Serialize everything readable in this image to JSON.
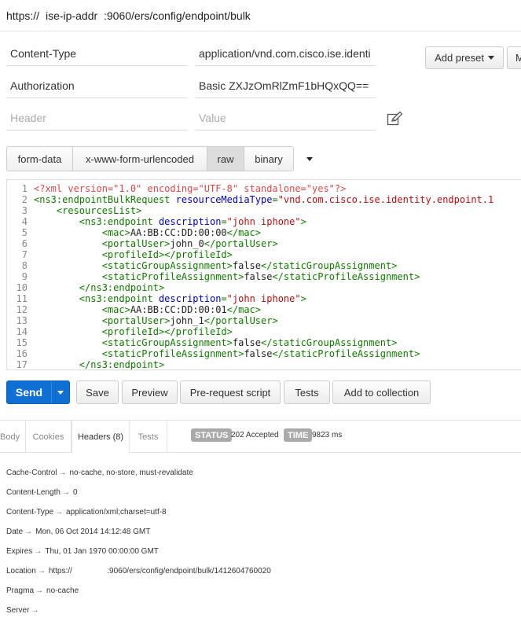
{
  "url": {
    "scheme": "https://",
    "host": "ise-ip-addr",
    "path": ":9060/ers/config/endpoint/bulk"
  },
  "headers": [
    {
      "key": "Content-Type",
      "value": "application/vnd.com.cisco.ise.identi"
    },
    {
      "key": "Authorization",
      "value": "Basic ZXJzOmRlZmF1bHQxQQ=="
    }
  ],
  "new_header": {
    "key_placeholder": "Header",
    "value_placeholder": "Value"
  },
  "preset_button": "Add preset",
  "partial_button": "M",
  "edit_icon": "edit-icon",
  "body_tabs": [
    {
      "label": "form-data",
      "active": false
    },
    {
      "label": "x-www-form-urlencoded",
      "active": false
    },
    {
      "label": "raw",
      "active": true
    },
    {
      "label": "binary",
      "active": false
    }
  ],
  "code": [
    {
      "n": "1",
      "tokens": [
        {
          "t": "decl",
          "v": "<?xml version=\"1.0\" encoding=\"UTF-8\" standalone=\"yes\"?>"
        }
      ]
    },
    {
      "n": "2",
      "tokens": [
        {
          "t": "tag",
          "v": "<ns3:endpointBulkRequest "
        },
        {
          "t": "attr",
          "v": "resourceMediaType"
        },
        {
          "t": "tag",
          "v": "="
        },
        {
          "t": "str",
          "v": "\"vnd.com.cisco.ise.identity.endpoint.1"
        }
      ]
    },
    {
      "n": "3",
      "tokens": [
        {
          "t": "text",
          "v": "    "
        },
        {
          "t": "tag",
          "v": "<resourcesList>"
        }
      ]
    },
    {
      "n": "4",
      "tokens": [
        {
          "t": "text",
          "v": "        "
        },
        {
          "t": "tag",
          "v": "<ns3:endpoint "
        },
        {
          "t": "attr",
          "v": "description"
        },
        {
          "t": "tag",
          "v": "="
        },
        {
          "t": "str",
          "v": "\"john iphone\""
        },
        {
          "t": "tag",
          "v": ">"
        }
      ]
    },
    {
      "n": "5",
      "tokens": [
        {
          "t": "text",
          "v": "            "
        },
        {
          "t": "tag",
          "v": "<mac>"
        },
        {
          "t": "text",
          "v": "AA:BB:CC:DD:00:00"
        },
        {
          "t": "tag",
          "v": "</mac>"
        }
      ]
    },
    {
      "n": "6",
      "tokens": [
        {
          "t": "text",
          "v": "            "
        },
        {
          "t": "tag",
          "v": "<portalUser>"
        },
        {
          "t": "text",
          "v": "john_0"
        },
        {
          "t": "tag",
          "v": "</portalUser>"
        }
      ]
    },
    {
      "n": "7",
      "tokens": [
        {
          "t": "text",
          "v": "            "
        },
        {
          "t": "tag",
          "v": "<profileId></profileId>"
        }
      ]
    },
    {
      "n": "8",
      "tokens": [
        {
          "t": "text",
          "v": "            "
        },
        {
          "t": "tag",
          "v": "<staticGroupAssignment>"
        },
        {
          "t": "text",
          "v": "false"
        },
        {
          "t": "tag",
          "v": "</staticGroupAssignment>"
        }
      ]
    },
    {
      "n": "9",
      "tokens": [
        {
          "t": "text",
          "v": "            "
        },
        {
          "t": "tag",
          "v": "<staticProfileAssignment>"
        },
        {
          "t": "text",
          "v": "false"
        },
        {
          "t": "tag",
          "v": "</staticProfileAssignment>"
        }
      ]
    },
    {
      "n": "10",
      "tokens": [
        {
          "t": "text",
          "v": "        "
        },
        {
          "t": "tag",
          "v": "</ns3:endpoint>"
        }
      ]
    },
    {
      "n": "11",
      "tokens": [
        {
          "t": "text",
          "v": "        "
        },
        {
          "t": "tag",
          "v": "<ns3:endpoint "
        },
        {
          "t": "attr",
          "v": "description"
        },
        {
          "t": "tag",
          "v": "="
        },
        {
          "t": "str",
          "v": "\"john iphone\""
        },
        {
          "t": "tag",
          "v": ">"
        }
      ]
    },
    {
      "n": "12",
      "tokens": [
        {
          "t": "text",
          "v": "            "
        },
        {
          "t": "tag",
          "v": "<mac>"
        },
        {
          "t": "text",
          "v": "AA:BB:CC:DD:00:01"
        },
        {
          "t": "tag",
          "v": "</mac>"
        }
      ]
    },
    {
      "n": "13",
      "tokens": [
        {
          "t": "text",
          "v": "            "
        },
        {
          "t": "tag",
          "v": "<portalUser>"
        },
        {
          "t": "text",
          "v": "john_1"
        },
        {
          "t": "tag",
          "v": "</portalUser>"
        }
      ]
    },
    {
      "n": "14",
      "tokens": [
        {
          "t": "text",
          "v": "            "
        },
        {
          "t": "tag",
          "v": "<profileId></profileId>"
        }
      ]
    },
    {
      "n": "15",
      "tokens": [
        {
          "t": "text",
          "v": "            "
        },
        {
          "t": "tag",
          "v": "<staticGroupAssignment>"
        },
        {
          "t": "text",
          "v": "false"
        },
        {
          "t": "tag",
          "v": "</staticGroupAssignment>"
        }
      ]
    },
    {
      "n": "16",
      "tokens": [
        {
          "t": "text",
          "v": "            "
        },
        {
          "t": "tag",
          "v": "<staticProfileAssignment>"
        },
        {
          "t": "text",
          "v": "false"
        },
        {
          "t": "tag",
          "v": "</staticProfileAssignment>"
        }
      ]
    },
    {
      "n": "17",
      "tokens": [
        {
          "t": "text",
          "v": "        "
        },
        {
          "t": "tag",
          "v": "</ns3:endpoint>"
        }
      ]
    }
  ],
  "actions": {
    "send": "Send",
    "save": "Save",
    "preview": "Preview",
    "prerequest": "Pre-request script",
    "tests": "Tests",
    "add_collection": "Add to collection"
  },
  "response_tabs": [
    {
      "label": "Body",
      "active": false
    },
    {
      "label": "Cookies",
      "active": false
    },
    {
      "label": "Headers (8)",
      "active": true
    },
    {
      "label": "Tests",
      "active": false
    }
  ],
  "status": {
    "label": "STATUS",
    "value": "202 Accepted"
  },
  "time": {
    "label": "TIME",
    "value": "9823 ms"
  },
  "response_headers": [
    {
      "key": "Cache-Control",
      "value": "no-cache, no-store, must-revalidate"
    },
    {
      "key": "Content-Length",
      "value": "0"
    },
    {
      "key": "Content-Type",
      "value": "application/xml;charset=utf-8"
    },
    {
      "key": "Date",
      "value": "Mon, 06 Oct 2014 14:12:48 GMT"
    },
    {
      "key": "Expires",
      "value": "Thu, 01 Jan 1970 00:00:00 GMT"
    },
    {
      "key": "Location",
      "value": "https://                :9060/ers/config/endpoint/bulk/1412604760020"
    },
    {
      "key": "Pragma",
      "value": "no-cache"
    },
    {
      "key": "Server",
      "value": ""
    }
  ]
}
